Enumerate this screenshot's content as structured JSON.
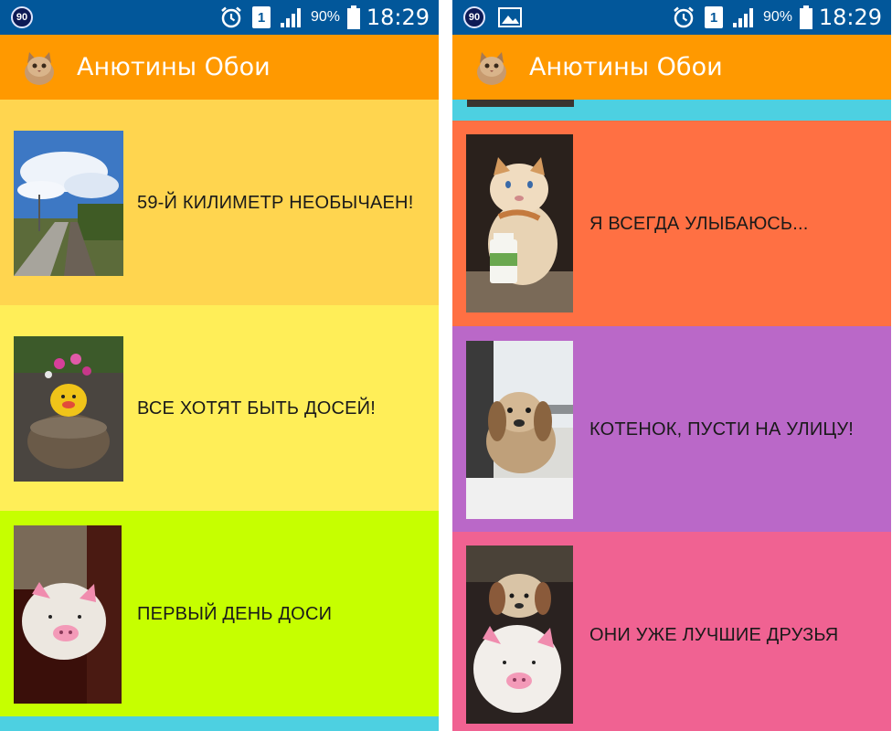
{
  "status_bar": {
    "notification_badge": "90",
    "battery_percent": "90%",
    "time": "18:29",
    "sim_label": "1"
  },
  "app": {
    "title": "Анютины Обои",
    "icon": "kitten-icon"
  },
  "left_list": {
    "items": [
      {
        "label": "59-Й КИЛИМЕТР НЕОБЫЧАЕН!",
        "bg": "#ffd54f",
        "thumb": "railway-platform-photo"
      },
      {
        "label": "ВСЕ ХОТЯТ БЫТЬ ДОСЕЙ!",
        "bg": "#ffee58",
        "thumb": "pig-flowerpot-photo"
      },
      {
        "label": "ПЕРВЫЙ ДЕНЬ ДОСИ",
        "bg": "#c6ff00",
        "thumb": "plush-pig-photo"
      }
    ],
    "next_strip_bg": "#4dd0e1"
  },
  "right_list": {
    "prev_strip_bg": "#4dd0e1",
    "items": [
      {
        "label": "Я ВСЕГДА УЛЫБАЮСЬ...",
        "bg": "#ff7043",
        "thumb": "plush-cat-photo"
      },
      {
        "label": "КОТЕНОК, ПУСТИ НА УЛИЦУ!",
        "bg": "#ba68c8",
        "thumb": "plush-puppy-window-photo"
      },
      {
        "label": "ОНИ УЖЕ ЛУЧШИЕ ДРУЗЬЯ",
        "bg": "#f06292",
        "thumb": "plush-puppy-pig-photo"
      }
    ]
  },
  "colors": {
    "status_bar": "#02579a",
    "toolbar": "#ff9900"
  }
}
